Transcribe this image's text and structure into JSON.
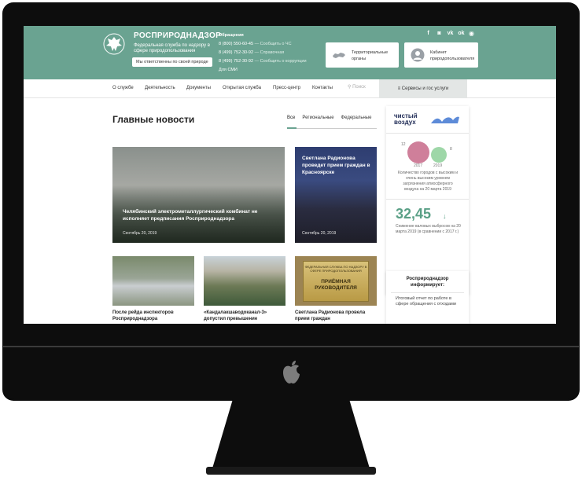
{
  "header": {
    "brand": "РОСПРИРОДНАДЗОР",
    "subtitle": "Федеральная служба по надзору в сфере природопользования",
    "mission_button": "Мы ответственны по своей природе",
    "contacts_title": "Обращения",
    "phones": [
      {
        "number": "8 (800) 550-60-45",
        "label": "— Сообщить о ЧС"
      },
      {
        "number": "8 (499) 752-30-92",
        "label": "— Справочная"
      },
      {
        "number": "8 (499) 752-30-92",
        "label": "— Сообщить о коррупции"
      }
    ],
    "media": "Для СМИ",
    "tile_regions": "Территориальные органы",
    "tile_cabinet": "Кабинет природопользователя",
    "socials": [
      "f",
      "◙",
      "vk",
      "ok"
    ]
  },
  "nav": {
    "items": [
      "О службе",
      "Деятельность",
      "Документы",
      "Открытая служба",
      "Пресс-центр",
      "Контакты"
    ],
    "search_placeholder": "Поиск",
    "services": "Сервисы и гос услуги"
  },
  "news": {
    "heading": "Главные новости",
    "filters": [
      "Все",
      "Региональные",
      "Федеральные"
    ],
    "big_card": {
      "title": "Челябинский электрометаллургический комбинат не исполняет предписания Росприроднадзора",
      "date": "Сентябрь 20, 2019"
    },
    "side_card": {
      "title": "Светлана Радионова проведет прием граждан в Красноярске",
      "date": "Сентябрь 20, 2019"
    },
    "thumbs": [
      {
        "caption": "После рейда инспекторов Росприроднадзора"
      },
      {
        "caption": "«Кандалакшаводоканал-3» допустил превышение"
      },
      {
        "caption": "Светлана Радионова провела прием граждан"
      }
    ],
    "plaque_small": "ФЕДЕРАЛЬНАЯ СЛУЖБА ПО НАДЗОРУ В СФЕРЕ ПРИРОДОПОЛЬЗОВАНИЯ",
    "plaque_big": "ПРИЁМНАЯ РУКОВОДИТЕЛЯ"
  },
  "sidebar": {
    "logo_line1": "чистый",
    "logo_line2": "воздух",
    "bubble_left_value": "12",
    "bubble_right_value": "8",
    "year_left": "2017",
    "year_right": "2019",
    "stat_desc": "Количество городов с высоким и очень высоким уровнем загрязнения атмосферного воздуха на 20 марта 2019",
    "big_number": "32,45",
    "stat2_desc": "Снижение валовых выбросов на 20 марта 2019 (в сравнении с 2017 г.)",
    "informs_title": "Росприроднадзор информирует:",
    "informs_text": "Итоговый отчет по работе в сфере обращения с отходами"
  },
  "colors": {
    "brand": "#6aa391",
    "accent_green": "#5aa086",
    "bubble_pink": "#cf7f9a",
    "bubble_green": "#9ed7a8"
  }
}
